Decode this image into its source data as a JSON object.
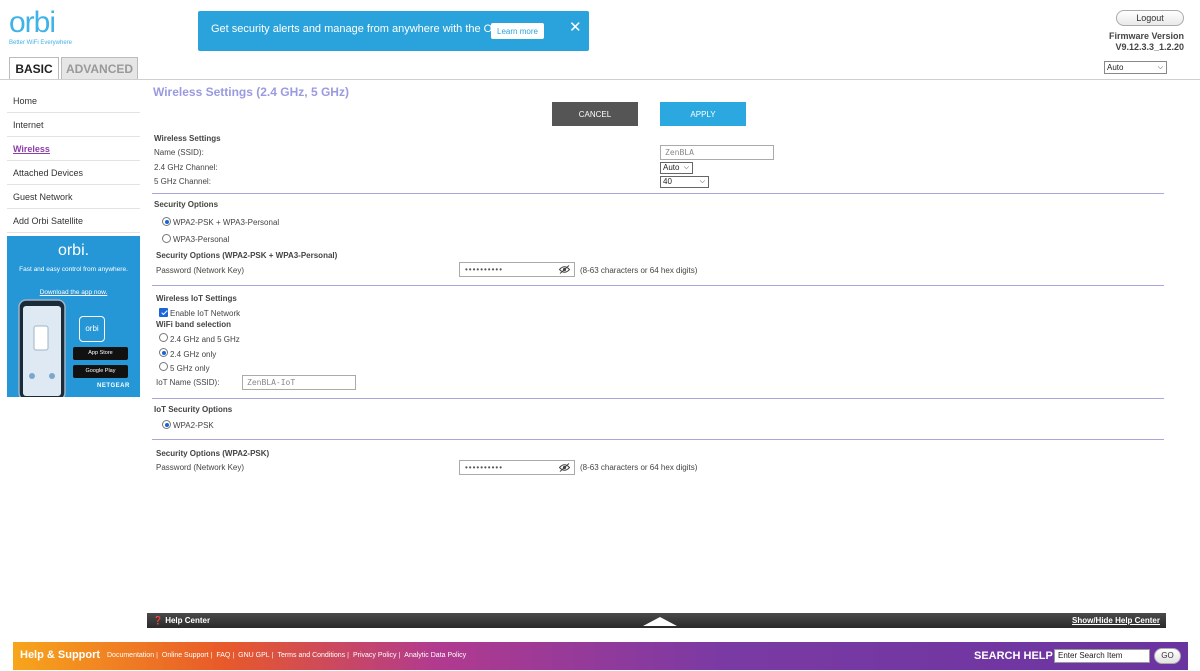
{
  "brand": {
    "name": "orbi",
    "tagline": "Better WiFi Everywhere"
  },
  "banner": {
    "text": "Get security alerts and manage from anywhere with the Orbi App.",
    "learn_more": "Learn more",
    "close_symbol": "✕"
  },
  "header": {
    "logout": "Logout",
    "firmware_label": "Firmware Version",
    "firmware_value": "V9.12.3.3_1.2.20",
    "language_value": "Auto"
  },
  "tabs": {
    "basic": "BASIC",
    "advanced": "ADVANCED",
    "active": "basic"
  },
  "sidebar": {
    "items": [
      {
        "label": "Home"
      },
      {
        "label": "Internet"
      },
      {
        "label": "Wireless",
        "active": true
      },
      {
        "label": "Attached Devices"
      },
      {
        "label": "Guest Network"
      },
      {
        "label": "Add Orbi Satellite"
      }
    ]
  },
  "ad": {
    "logo": "orbi.",
    "text": "Fast and easy control from anywhere.",
    "link": "Download the app now.",
    "app_icon_text": "orbi",
    "app_store": "App Store",
    "google_play": "Google Play",
    "brand": "NETGEAR"
  },
  "page": {
    "title": "Wireless Settings (2.4 GHz, 5 GHz)",
    "cancel": "CANCEL",
    "apply": "APPLY"
  },
  "wireless": {
    "heading": "Wireless Settings",
    "ssid_label": "Name (SSID):",
    "ssid_value": "ZenBLA",
    "ch24_label": "2.4 GHz Channel:",
    "ch24_value": "Auto",
    "ch5_label": "5 GHz Channel:",
    "ch5_value": "40"
  },
  "security": {
    "heading": "Security Options",
    "options": [
      {
        "label": "WPA2-PSK + WPA3-Personal",
        "selected": true
      },
      {
        "label": "WPA3-Personal",
        "selected": false
      }
    ],
    "sub_heading": "Security Options (WPA2-PSK + WPA3-Personal)",
    "password_label": "Password (Network Key)",
    "password_mask": "••••••••••",
    "password_hint": "(8-63 characters or 64 hex digits)"
  },
  "iot": {
    "heading": "Wireless IoT Settings",
    "enable_label": "Enable IoT Network",
    "enable_checked": true,
    "band_heading": "WiFi band selection",
    "bands": [
      {
        "label": "2.4 GHz and 5 GHz",
        "selected": false
      },
      {
        "label": "2.4 GHz only",
        "selected": true
      },
      {
        "label": "5 GHz only",
        "selected": false
      }
    ],
    "ssid_label": "IoT Name (SSID):",
    "ssid_value": "ZenBLA-IoT"
  },
  "iot_security": {
    "heading": "IoT Security Options",
    "option_label": "WPA2-PSK",
    "sub_heading": "Security Options (WPA2-PSK)",
    "password_label": "Password (Network Key)",
    "password_mask": "••••••••••",
    "password_hint": "(8-63 characters or 64 hex digits)"
  },
  "help_bar": {
    "left": "Help Center",
    "right": "Show/Hide Help Center"
  },
  "footer": {
    "title": "Help & Support",
    "links": [
      "Documentation",
      "Online Support",
      "FAQ",
      "GNU GPL",
      "Terms and Conditions",
      "Privacy Policy",
      "Analytic Data Policy"
    ],
    "search_label": "SEARCH HELP",
    "search_placeholder": "Enter Search Item",
    "go": "GO"
  },
  "colors": {
    "accent": "#2aa8df",
    "title": "#9a9ae0",
    "active_nav": "#8c3fa6",
    "divider": "#a7a7dd"
  }
}
